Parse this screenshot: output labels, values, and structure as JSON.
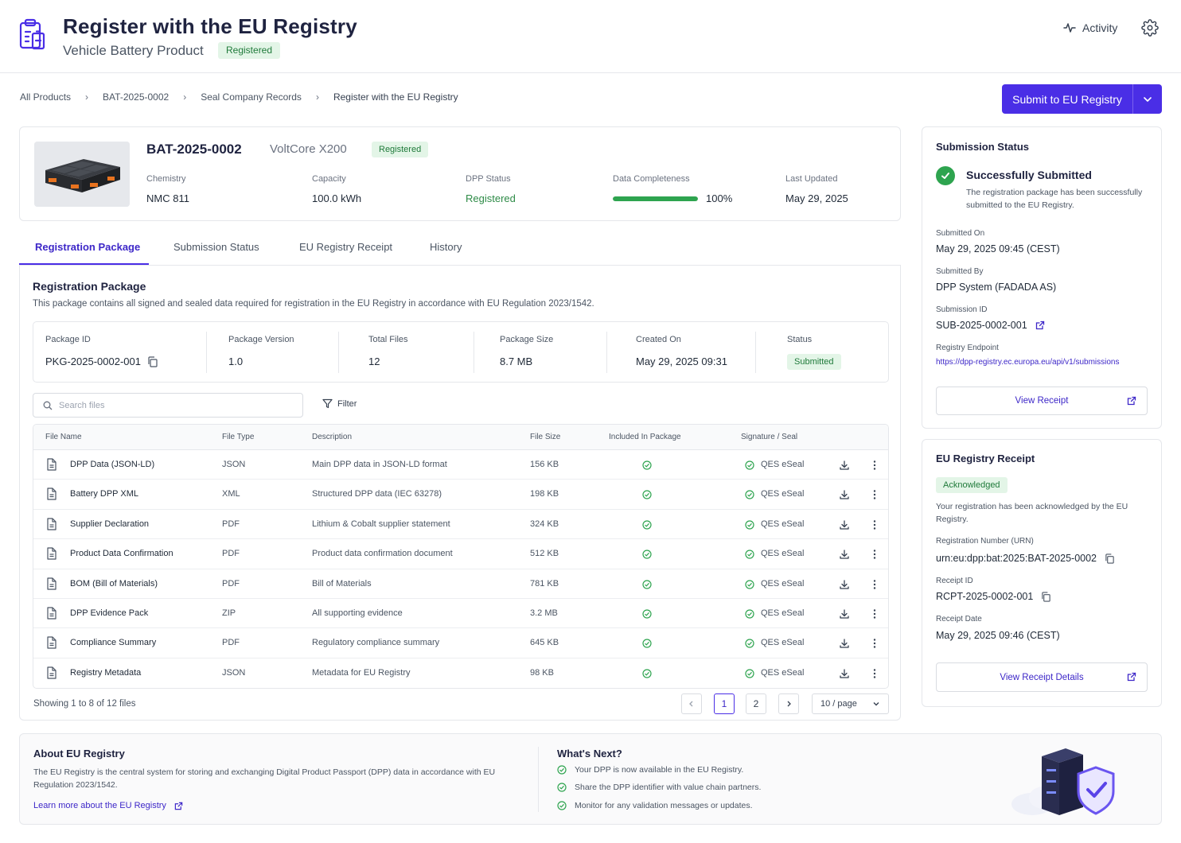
{
  "header": {
    "title": "Register with the EU Registry",
    "subtitle": "Vehicle Battery Product",
    "badge": "Registered",
    "activity_label": "Activity",
    "icons": {
      "logo": "clipboard-battery-icon",
      "activity": "activity-icon",
      "settings": "gear-icon"
    }
  },
  "breadcrumb": {
    "items": [
      "All Products",
      "BAT-2025-0002",
      "Seal Company Records",
      "Register with the EU Registry"
    ],
    "separator": "›"
  },
  "actions": {
    "submit_label": "Submit to EU Registry"
  },
  "product": {
    "id": "BAT-2025-0002",
    "model": "VoltCore X200",
    "badge": "Registered",
    "fields": [
      {
        "label": "Chemistry",
        "value": "NMC 811"
      },
      {
        "label": "Capacity",
        "value": "100.0 kWh"
      },
      {
        "label": "DPP Status",
        "value": "Registered"
      },
      {
        "label": "Data Completeness",
        "value": "100%"
      },
      {
        "label": "Last Updated",
        "value": "May 29, 2025"
      }
    ],
    "completeness_fraction": 1.0
  },
  "tabs": [
    "Registration Package",
    "Submission Status",
    "EU Registry Receipt",
    "History"
  ],
  "active_tab": "Registration Package",
  "package": {
    "title": "Registration Package",
    "description": "This package contains all signed and sealed data required for registration in the EU Registry in accordance with EU Regulation 2023/1542.",
    "fields": [
      {
        "label": "Package ID",
        "value": "PKG-2025-0002-001"
      },
      {
        "label": "Package Version",
        "value": "1.0"
      },
      {
        "label": "Total Files",
        "value": "12"
      },
      {
        "label": "Package Size",
        "value": "8.7 MB"
      },
      {
        "label": "Created On",
        "value": "May 29, 2025 09:31"
      },
      {
        "label": "Status",
        "value": "Submitted"
      }
    ]
  },
  "files": {
    "search_placeholder": "Search files",
    "filter_label": "Filter",
    "columns": [
      "File Name",
      "File Type",
      "Description",
      "File Size",
      "Included In Package",
      "Signature / Seal"
    ],
    "rows": [
      {
        "name": "DPP Data (JSON-LD)",
        "type": "JSON",
        "description": "Main DPP data in JSON-LD format",
        "size": "156 KB",
        "included": true,
        "seal": "QES eSeal"
      },
      {
        "name": "Battery DPP XML",
        "type": "XML",
        "description": "Structured DPP data (IEC 63278)",
        "size": "198 KB",
        "included": true,
        "seal": "QES eSeal"
      },
      {
        "name": "Supplier Declaration",
        "type": "PDF",
        "description": "Lithium & Cobalt supplier statement",
        "size": "324 KB",
        "included": true,
        "seal": "QES eSeal"
      },
      {
        "name": "Product Data Confirmation",
        "type": "PDF",
        "description": "Product data confirmation document",
        "size": "512 KB",
        "included": true,
        "seal": "QES eSeal"
      },
      {
        "name": "BOM (Bill of Materials)",
        "type": "PDF",
        "description": "Bill of Materials",
        "size": "781 KB",
        "included": true,
        "seal": "QES eSeal"
      },
      {
        "name": "DPP Evidence Pack",
        "type": "ZIP",
        "description": "All supporting evidence",
        "size": "3.2 MB",
        "included": true,
        "seal": "QES eSeal"
      },
      {
        "name": "Compliance Summary",
        "type": "PDF",
        "description": "Regulatory compliance summary",
        "size": "645 KB",
        "included": true,
        "seal": "QES eSeal"
      },
      {
        "name": "Registry Metadata",
        "type": "JSON",
        "description": "Metadata for EU Registry",
        "size": "98 KB",
        "included": true,
        "seal": "QES eSeal"
      }
    ],
    "showing": "Showing 1 to 8 of 12 files",
    "pages": [
      "1",
      "2"
    ],
    "current_page": "1",
    "per_page": "10 / page"
  },
  "submission_status": {
    "title": "Submission Status",
    "success_title": "Successfully Submitted",
    "success_desc": "The registration package has been successfully submitted to the EU Registry.",
    "fields": [
      {
        "label": "Submitted On",
        "value": "May 29, 2025 09:45 (CEST)"
      },
      {
        "label": "Submitted By",
        "value": "DPP System (FADADA AS)"
      },
      {
        "label": "Submission ID",
        "value": "SUB-2025-0002-001"
      }
    ],
    "endpoint_label": "Registry Endpoint",
    "endpoint_url": "https://dpp-registry.ec.europa.eu/api/v1/submissions",
    "view_receipt_label": "View Receipt"
  },
  "receipt": {
    "title": "EU Registry Receipt",
    "badge": "Acknowledged",
    "desc": "Your registration has been acknowledged by the EU Registry.",
    "fields": [
      {
        "label": "Registration Number (URN)",
        "value": "urn:eu:dpp:bat:2025:BAT-2025-0002"
      },
      {
        "label": "Receipt ID",
        "value": "RCPT-2025-0002-001"
      },
      {
        "label": "Receipt Date",
        "value": "May 29, 2025 09:46 (CEST)"
      }
    ],
    "details_label": "View Receipt Details"
  },
  "about": {
    "title": "About EU Registry",
    "desc": "The EU Registry is the central system for storing and exchanging Digital Product Passport (DPP) data in accordance with EU Regulation 2023/1542.",
    "link": "Learn more about the EU Registry"
  },
  "next": {
    "title": "What's Next?",
    "items": [
      "Your DPP is now available in the EU Registry.",
      "Share the DPP identifier with value chain partners.",
      "Monitor for any validation messages or updates."
    ]
  },
  "colors": {
    "accent": "#4a2ee6",
    "success": "#2ea44f",
    "badge_bg": "#e3f5e7",
    "badge_text": "#1f7a3a"
  }
}
